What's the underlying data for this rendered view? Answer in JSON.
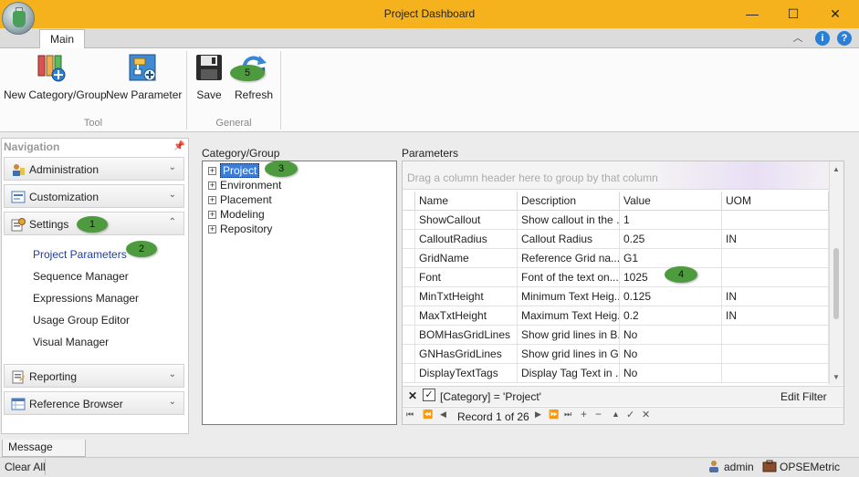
{
  "window": {
    "title": "Project Dashboard",
    "minimize": "—",
    "maximize": "☐",
    "close": "✕"
  },
  "ribbon": {
    "tab_main": "Main",
    "collapse": "︿",
    "info": "i",
    "help": "?",
    "groups": {
      "tool": {
        "label": "Tool",
        "new_category": "New Category/Group",
        "new_parameter": "New Parameter"
      },
      "general": {
        "label": "General",
        "save": "Save",
        "refresh": "Refresh"
      }
    }
  },
  "navigation": {
    "header": "Navigation",
    "pin": "📌",
    "groups": {
      "administration": "Administration",
      "customization": "Customization",
      "settings": "Settings",
      "reporting": "Reporting",
      "reference_browser": "Reference Browser"
    },
    "chevrons": {
      "down": "⌄",
      "up": "⌃"
    },
    "settings_items": [
      "Project Parameters",
      "Sequence Manager",
      "Expressions Manager",
      "Usage Group Editor",
      "Visual Manager"
    ]
  },
  "category_tree": {
    "label": "Category/Group",
    "expander": "+",
    "nodes": [
      "Project",
      "Environment",
      "Placement",
      "Modeling",
      "Repository"
    ]
  },
  "parameters": {
    "label": "Parameters",
    "group_hint": "Drag a column header here to group by that column",
    "columns": [
      "Name",
      "Description",
      "Value",
      "UOM"
    ],
    "rows": [
      [
        "ShowCallout",
        "Show callout in the ...",
        "1",
        ""
      ],
      [
        "CalloutRadius",
        "Callout Radius",
        "0.25",
        "IN"
      ],
      [
        "GridName",
        "Reference Grid na...",
        "G1",
        ""
      ],
      [
        "Font",
        "Font of the text on...",
        "1025",
        ""
      ],
      [
        "MinTxtHeight",
        "Minimum Text Heig...",
        "0.125",
        "IN"
      ],
      [
        "MaxTxtHeight",
        "Maximum Text Heig...",
        "0.2",
        "IN"
      ],
      [
        "BOMHasGridLines",
        "Show grid lines in B...",
        "No",
        ""
      ],
      [
        "GNHasGridLines",
        "Show grid lines in G...",
        "No",
        ""
      ],
      [
        "DisplayTextTags",
        "Display Tag Text in ...",
        "No",
        ""
      ]
    ],
    "filter": {
      "clear": "✕",
      "check": "✓",
      "text": "[Category] = 'Project'",
      "edit": "Edit Filter"
    },
    "navigator": {
      "record_text": "Record 1 of 26",
      "buttons": [
        "⏮",
        "⏪",
        "◀",
        "▶",
        "⏩",
        "⏭",
        "+",
        "−",
        "▲",
        "✓",
        "✕"
      ]
    },
    "scroll_up": "▲",
    "scroll_down": "▼"
  },
  "callouts": [
    "1",
    "2",
    "3",
    "4",
    "5"
  ],
  "bottom": {
    "message_viewer": "Message Viewer",
    "clear_all": "Clear All",
    "user": "admin",
    "unit_system": "OPSEMetric"
  }
}
